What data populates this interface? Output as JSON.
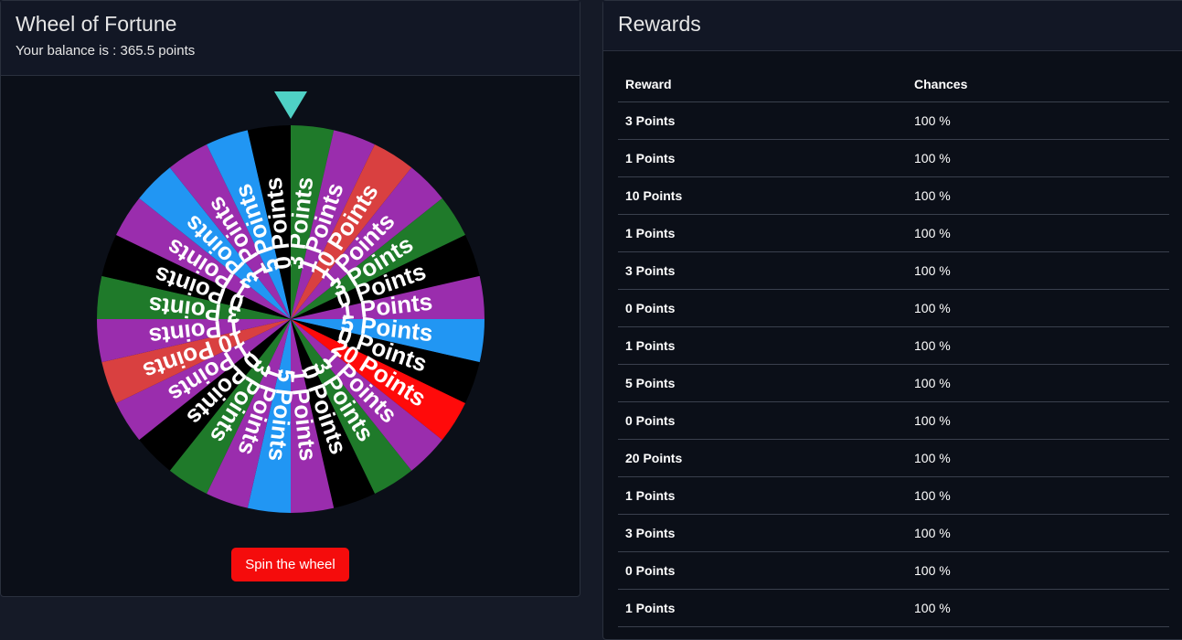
{
  "wheel_card": {
    "title": "Wheel of Fortune",
    "balance_text": "Your balance is : 365.5 points",
    "spin_label": "Spin the wheel",
    "pointer_color": "#4fd1c5",
    "segments": [
      {
        "label": "3 Points",
        "color": "#1f7a2a"
      },
      {
        "label": "1 Points",
        "color": "#9a2dad"
      },
      {
        "label": "10 Points",
        "color": "#d94040"
      },
      {
        "label": "1 Points",
        "color": "#9a2dad"
      },
      {
        "label": "3 Points",
        "color": "#1f7a2a"
      },
      {
        "label": "0 Points",
        "color": "#000000"
      },
      {
        "label": "1 Points",
        "color": "#9a2dad"
      },
      {
        "label": "5 Points",
        "color": "#2196f3"
      },
      {
        "label": "0 Points",
        "color": "#000000"
      },
      {
        "label": "20 Points",
        "color": "#ff0a0a"
      },
      {
        "label": "1 Points",
        "color": "#9a2dad"
      },
      {
        "label": "3 Points",
        "color": "#1f7a2a"
      },
      {
        "label": "0 Points",
        "color": "#000000"
      },
      {
        "label": "1 Points",
        "color": "#9a2dad"
      },
      {
        "label": "5 Points",
        "color": "#2196f3"
      },
      {
        "label": "1 Points",
        "color": "#9a2dad"
      },
      {
        "label": "3 Points",
        "color": "#1f7a2a"
      },
      {
        "label": "0 Points",
        "color": "#000000"
      },
      {
        "label": "1 Points",
        "color": "#9a2dad"
      },
      {
        "label": "10 Points",
        "color": "#d94040"
      },
      {
        "label": "1 Points",
        "color": "#9a2dad"
      },
      {
        "label": "3 Points",
        "color": "#1f7a2a"
      },
      {
        "label": "0 Points",
        "color": "#000000"
      },
      {
        "label": "1 Points",
        "color": "#9a2dad"
      },
      {
        "label": "3 Points",
        "color": "#2196f3"
      },
      {
        "label": "1 Points",
        "color": "#9a2dad"
      },
      {
        "label": "5 Points",
        "color": "#2196f3"
      },
      {
        "label": "0 Points",
        "color": "#000000"
      }
    ]
  },
  "rewards_card": {
    "title": "Rewards",
    "headers": {
      "reward": "Reward",
      "chances": "Chances"
    },
    "rows": [
      {
        "reward": "3 Points",
        "chance": "100 %"
      },
      {
        "reward": "1 Points",
        "chance": "100 %"
      },
      {
        "reward": "10 Points",
        "chance": "100 %"
      },
      {
        "reward": "1 Points",
        "chance": "100 %"
      },
      {
        "reward": "3 Points",
        "chance": "100 %"
      },
      {
        "reward": "0 Points",
        "chance": "100 %"
      },
      {
        "reward": "1 Points",
        "chance": "100 %"
      },
      {
        "reward": "5 Points",
        "chance": "100 %"
      },
      {
        "reward": "0 Points",
        "chance": "100 %"
      },
      {
        "reward": "20 Points",
        "chance": "100 %"
      },
      {
        "reward": "1 Points",
        "chance": "100 %"
      },
      {
        "reward": "3 Points",
        "chance": "100 %"
      },
      {
        "reward": "0 Points",
        "chance": "100 %"
      },
      {
        "reward": "1 Points",
        "chance": "100 %"
      }
    ]
  }
}
